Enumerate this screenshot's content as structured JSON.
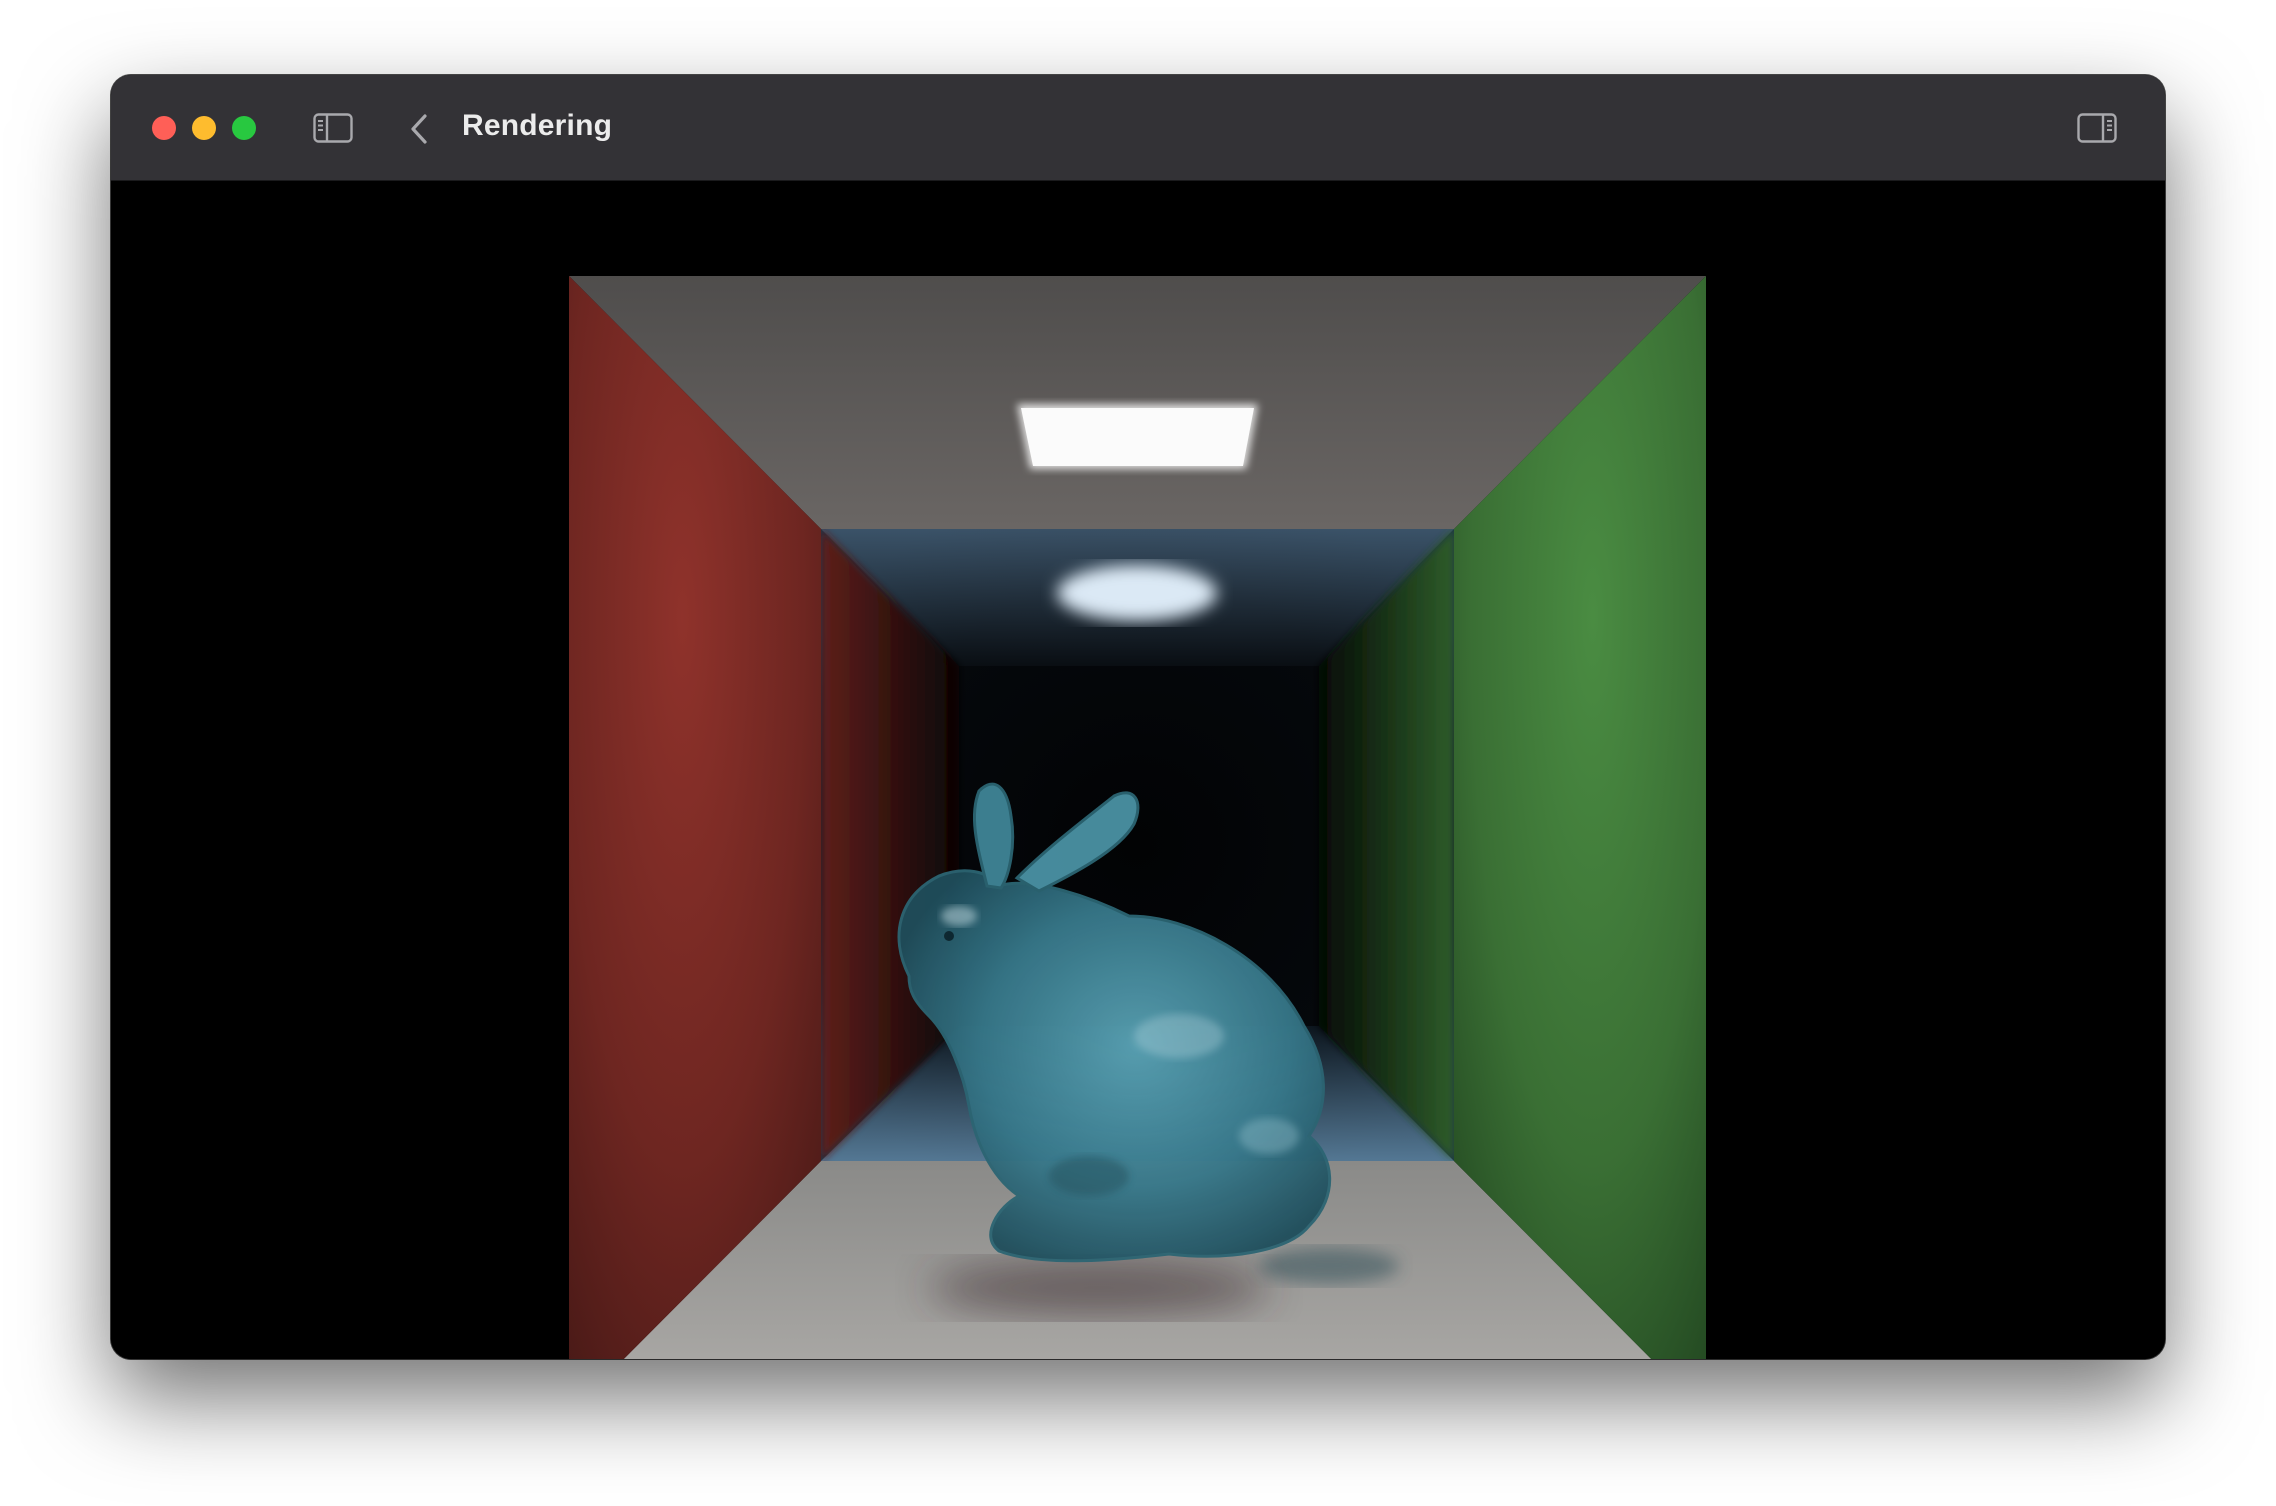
{
  "window": {
    "title": "Rendering"
  },
  "titlebar": {
    "controls": [
      "close",
      "minimize",
      "zoom"
    ],
    "icons": {
      "sidebar": "sidebar-left-icon",
      "back": "chevron-left-icon",
      "inspector": "sidebar-right-icon"
    }
  },
  "colors": {
    "titlebar": "#333236",
    "close": "#ff5f57",
    "minimize": "#febc2e",
    "zoom": "#28c840",
    "left_wall": "#7a2a25",
    "right_wall": "#3f7a38",
    "ceiling": "#5a5756",
    "floor": "#a3a19e",
    "bunny": "#3c7d8c"
  }
}
